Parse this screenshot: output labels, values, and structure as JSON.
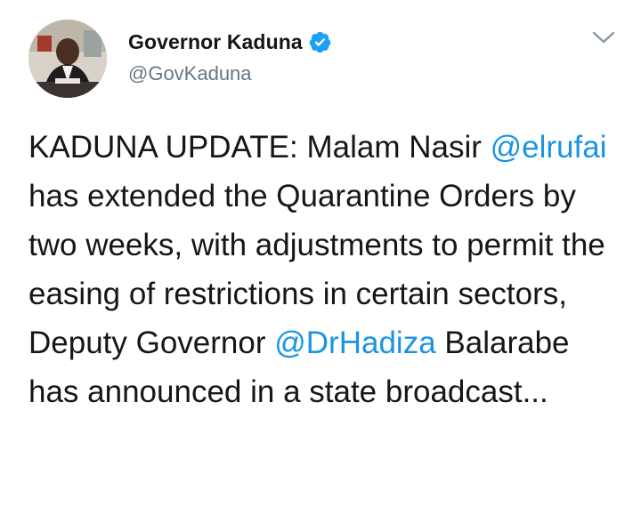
{
  "tweet": {
    "author": {
      "display_name": "Governor Kaduna",
      "handle": "@GovKaduna",
      "verified_icon": "verified-badge-icon",
      "avatar": "profile-photo"
    },
    "menu_icon": "chevron-down-icon",
    "text": {
      "part1": "KADUNA UPDATE: Malam Nasir ",
      "mention1": "@elrufai",
      "part2": " has extended the Quarantine Orders by two weeks, with adjustments to permit the easing of restrictions in certain sectors, Deputy Governor ",
      "mention2": "@DrHadiza",
      "part3": " Balarabe has announced in a state broadcast..."
    }
  },
  "colors": {
    "text": "#14171a",
    "secondary": "#657786",
    "link": "#1b95e0",
    "verified": "#1da1f2"
  }
}
